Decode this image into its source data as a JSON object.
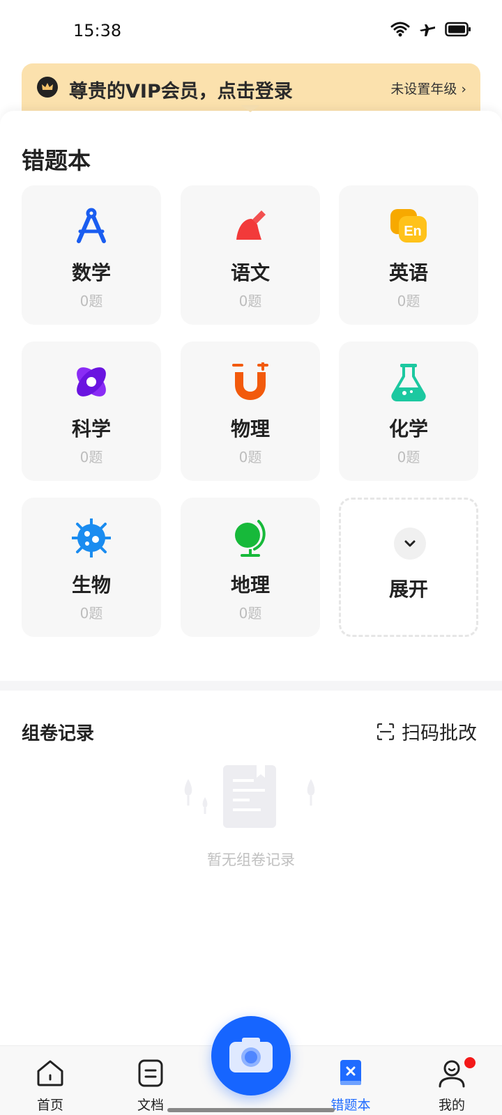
{
  "status_bar": {
    "time": "15:38"
  },
  "vip_banner": {
    "title": "尊贵的VIP会员，点击登录",
    "grade_text": "未设置年级 ›"
  },
  "mistake_book": {
    "title": "错题本",
    "subjects": [
      {
        "name": "数学",
        "count": "0题",
        "icon": "compass-icon",
        "color": "#1a5df0"
      },
      {
        "name": "语文",
        "count": "0题",
        "icon": "brush-icon",
        "color": "#f23a3a"
      },
      {
        "name": "英语",
        "count": "0题",
        "icon": "english-bubble-icon",
        "color": "#f7a900"
      },
      {
        "name": "科学",
        "count": "0题",
        "icon": "atom-icon",
        "color": "#7a1cf0"
      },
      {
        "name": "物理",
        "count": "0题",
        "icon": "magnet-icon",
        "color": "#f25a0c"
      },
      {
        "name": "化学",
        "count": "0题",
        "icon": "flask-icon",
        "color": "#1cc8a0"
      },
      {
        "name": "生物",
        "count": "0题",
        "icon": "cell-icon",
        "color": "#1a8cf0"
      },
      {
        "name": "地理",
        "count": "0题",
        "icon": "globe-icon",
        "color": "#17b93a"
      }
    ],
    "expand_label": "展开"
  },
  "records": {
    "title": "组卷记录",
    "scan_label": "扫码批改",
    "empty_text": "暂无组卷记录"
  },
  "tab_bar": {
    "tabs": [
      {
        "label": "首页",
        "icon": "home-icon"
      },
      {
        "label": "文档",
        "icon": "document-icon"
      },
      {
        "label": "错题本",
        "icon": "mistake-book-icon",
        "active": true
      },
      {
        "label": "我的",
        "icon": "profile-icon"
      }
    ]
  },
  "colors": {
    "accent": "#1665ff",
    "vip_bg": "#fbe1ad",
    "badge": "#f31919"
  }
}
